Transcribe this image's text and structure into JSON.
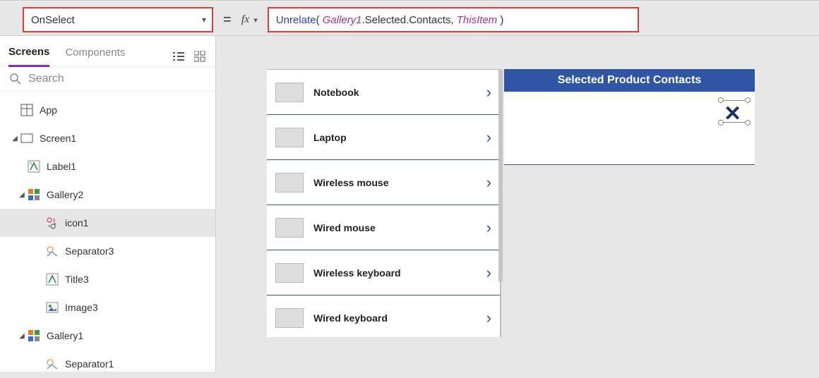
{
  "topbar": {
    "property_name": "OnSelect",
    "formula": {
      "func": "Unrelate",
      "arg1_obj": "Gallery1",
      "arg1_rest": ".Selected.Contacts,",
      "arg2": "ThisItem"
    }
  },
  "left_panel": {
    "tabs": {
      "screens": "Screens",
      "components": "Components"
    },
    "search_placeholder": "Search",
    "tree": {
      "app": "App",
      "screen1": "Screen1",
      "label1": "Label1",
      "gallery2": "Gallery2",
      "icon1": "icon1",
      "separator3": "Separator3",
      "title3": "Title3",
      "image3": "Image3",
      "gallery1": "Gallery1",
      "separator1": "Separator1"
    }
  },
  "canvas": {
    "products": [
      "Notebook",
      "Laptop",
      "Wireless mouse",
      "Wired mouse",
      "Wireless keyboard",
      "Wired keyboard"
    ],
    "contacts_header": "Selected Product Contacts"
  }
}
